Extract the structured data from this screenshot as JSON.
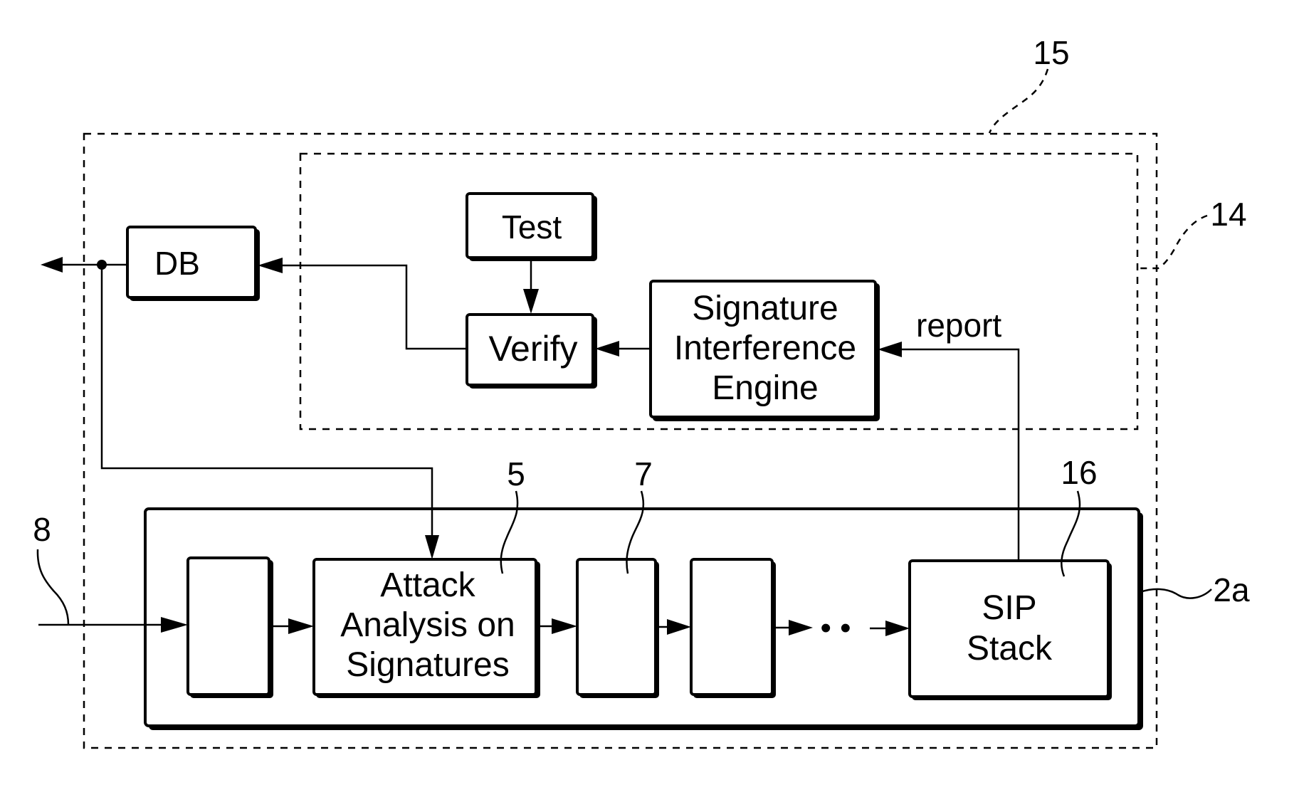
{
  "diagram": {
    "blocks": {
      "db": {
        "label": "DB"
      },
      "test": {
        "label": "Test"
      },
      "verify": {
        "label": "Verify"
      },
      "sie": {
        "lines": [
          "Signature",
          "Interference",
          "Engine"
        ]
      },
      "attack": {
        "lines": [
          "Attack",
          "Analysis on",
          "Signatures"
        ]
      },
      "sip": {
        "lines": [
          "SIP",
          "Stack"
        ]
      },
      "stage1": {
        "label": ""
      },
      "stage3": {
        "label": ""
      },
      "stage4": {
        "label": ""
      }
    },
    "edge_labels": {
      "report": "report",
      "ellipsis": "• •"
    },
    "reference_numerals": {
      "outer_system": "15",
      "inner_group": "14",
      "pipeline": "2a",
      "input": "8",
      "attack_module": "5",
      "module_7": "7",
      "sip_stack": "16"
    }
  }
}
